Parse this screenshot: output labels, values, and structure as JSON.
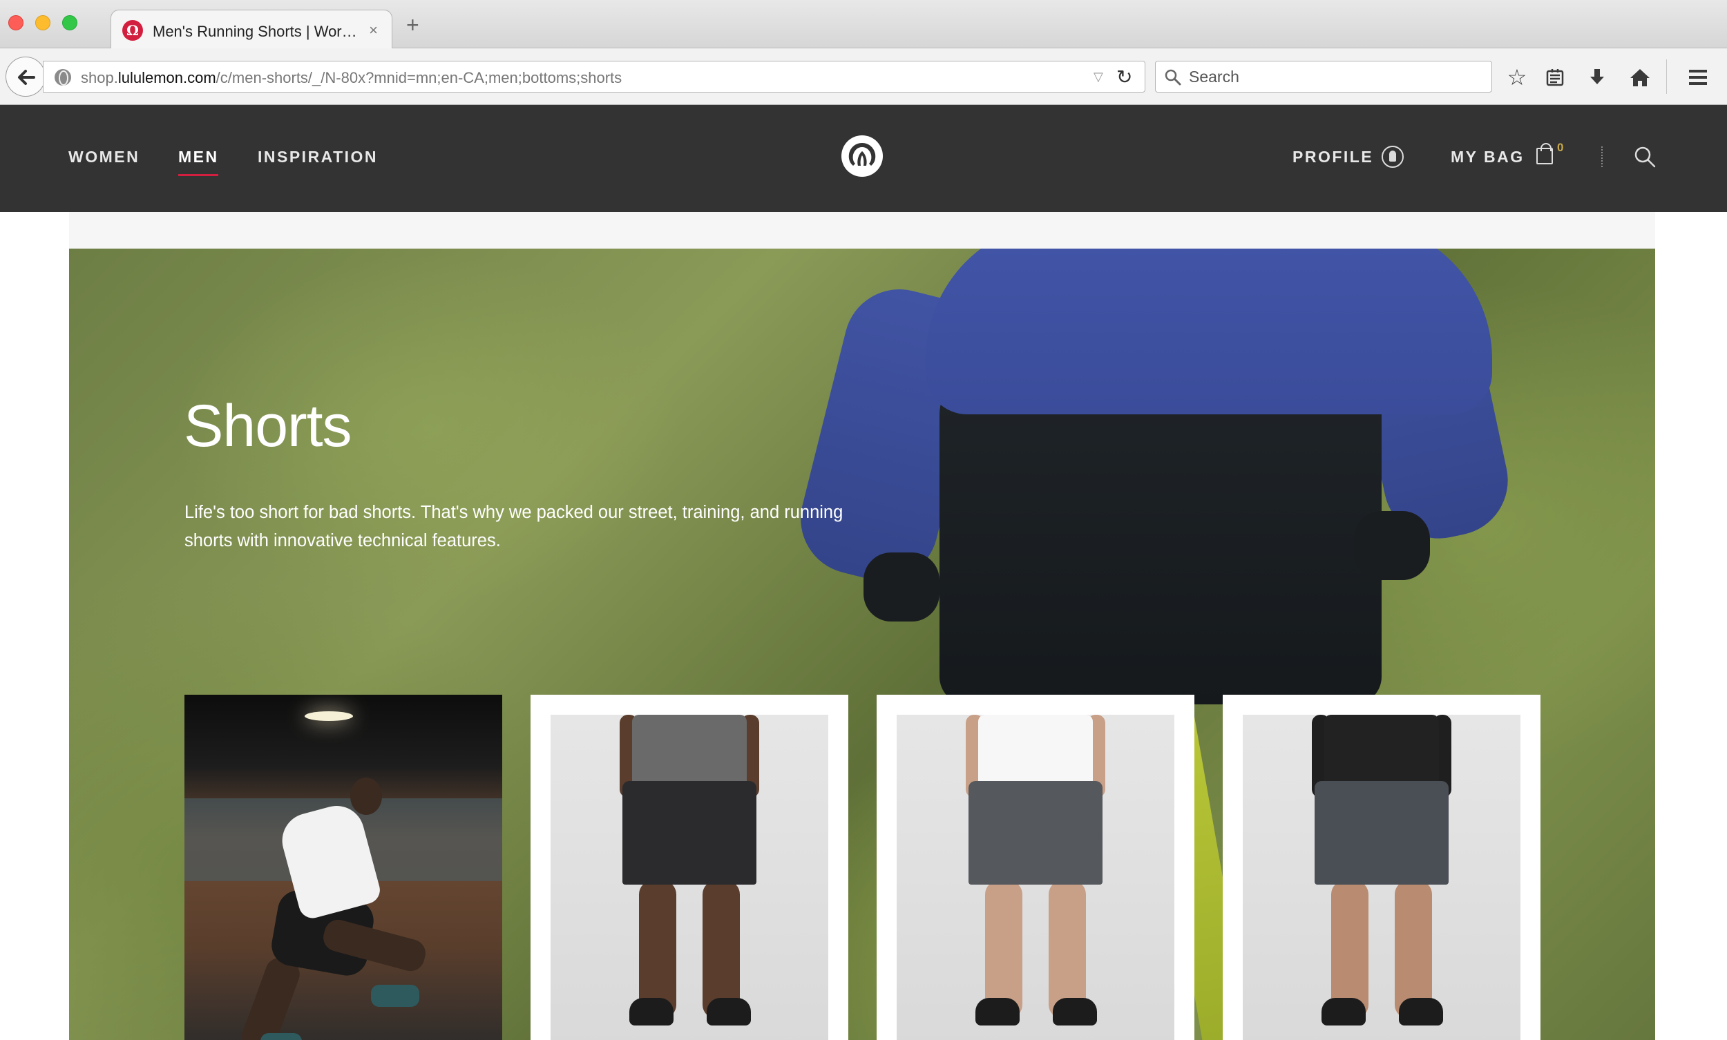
{
  "browser": {
    "tab_title": "Men's Running Shorts | Wor…",
    "tab_close": "×",
    "new_tab": "+",
    "url_prefix": "shop.",
    "url_domain": "lululemon.com",
    "url_path": "/c/men-shorts/_/N-80x?mnid=mn;en-CA;men;bottoms;shorts",
    "search_placeholder": "Search"
  },
  "site": {
    "nav": [
      {
        "label": "WOMEN"
      },
      {
        "label": "MEN",
        "active": true
      },
      {
        "label": "INSPIRATION"
      }
    ],
    "profile_label": "PROFILE",
    "bag_label": "MY BAG",
    "bag_count": "0",
    "accent_color": "#d31f3f",
    "header_bg": "#333333"
  },
  "hero": {
    "title": "Shorts",
    "description": "Life's too short for bad shorts. That's why we packed our street, training, and running shorts with innovative technical features."
  },
  "products": [
    {
      "kind": "lifestyle-photo",
      "shorts_color": "#1a1a1a"
    },
    {
      "kind": "product-photo",
      "top_color": "#5f5f5f",
      "shorts_color": "#2b2b2e",
      "skin": "#5a3d2c"
    },
    {
      "kind": "product-photo",
      "top_color": "#f4f4f4",
      "shorts_color": "#55585d",
      "skin": "#c8a088"
    },
    {
      "kind": "product-photo",
      "top_color": "#1f1f1f",
      "shorts_color": "#4a4e55",
      "skin": "#b98b70"
    }
  ]
}
